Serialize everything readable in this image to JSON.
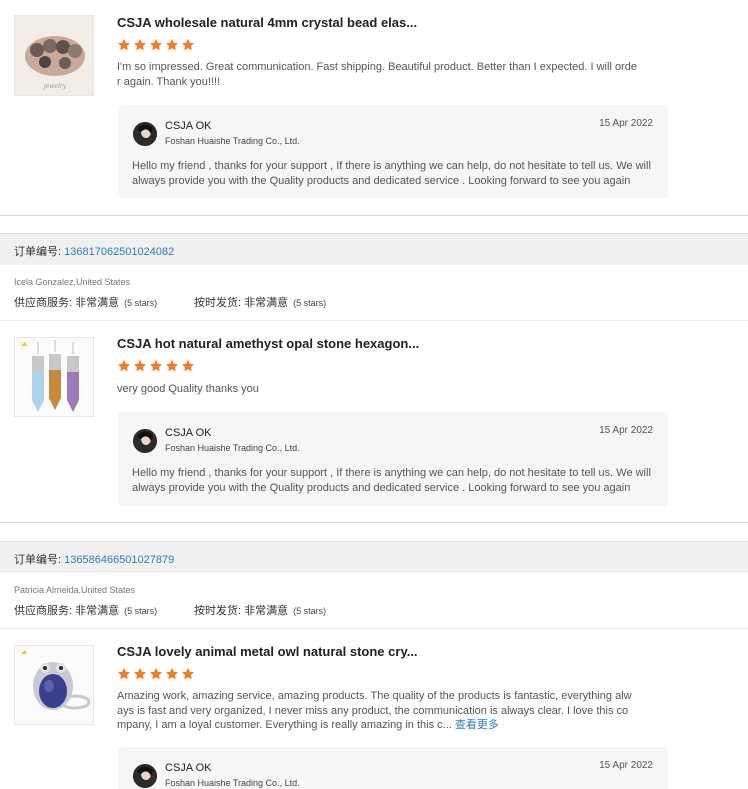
{
  "reviews": [
    {
      "title": "CSJA wholesale natural 4mm crystal bead elas...",
      "rating": 5,
      "comment": "I'm so impressed.  Great communication.  Fast shipping.  Beautiful product.  Better than I expected.  I will order again.  Thank you!!!!",
      "see_more": "",
      "reply": {
        "seller_name": "CSJA OK",
        "company": "Foshan Huaishe Trading Co., Ltd.",
        "date": "15 Apr 2022",
        "text": "Hello my friend , thanks for your support , If there is anything we can help, do not hesitate to tell us. We will always provide you with the Quality products and dedicated service . Looking forward to see you again"
      }
    },
    {
      "title": "CSJA hot natural amethyst opal stone hexagon...",
      "rating": 5,
      "comment": "very good Quality thanks you",
      "see_more": "",
      "reply": {
        "seller_name": "CSJA OK",
        "company": "Foshan Huaishe Trading Co., Ltd.",
        "date": "15 Apr 2022",
        "text": "Hello my friend , thanks for your support , If there is anything we can help, do not hesitate to tell us. We will always provide you with the Quality products and dedicated service . Looking forward to see you again"
      }
    },
    {
      "title": "CSJA lovely animal metal owl natural stone cry...",
      "rating": 5,
      "comment": "Amazing work, amazing service, amazing products. The quality of the products is fantastic, everything always is fast and very organized, I never miss any product, the communication is always clear. I love this company, I am a loyal customer. Everything is really amazing in this c...",
      "see_more": "查看更多",
      "reply": {
        "seller_name": "CSJA OK",
        "company": "Foshan Huaishe Trading Co., Ltd.",
        "date": "15 Apr 2022",
        "text": ""
      }
    }
  ],
  "orders": [
    {
      "label": "订单编号:",
      "number": "136817062501024082",
      "buyer": "Icela Gonzalez,United States",
      "supplier_label": "供应商服务: 非常满意",
      "supplier_stars": "(5 stars)",
      "shipping_label": "按时发货: 非常满意",
      "shipping_stars": "(5 stars)"
    },
    {
      "label": "订单编号:",
      "number": "136586466501027879",
      "buyer": "Patricia Almeida,United States",
      "supplier_label": "供应商服务: 非常满意",
      "supplier_stars": "(5 stars)",
      "shipping_label": "按时发货: 非常满意",
      "shipping_stars": "(5 stars)"
    }
  ],
  "colors": {
    "star": "#f07c2a",
    "link": "#2a7ec2",
    "reply_bg": "#f6f6f8",
    "order_bar_bg": "#f0f0f0"
  },
  "icons": [
    "star-icon",
    "avatar",
    "product-thumbnail"
  ]
}
